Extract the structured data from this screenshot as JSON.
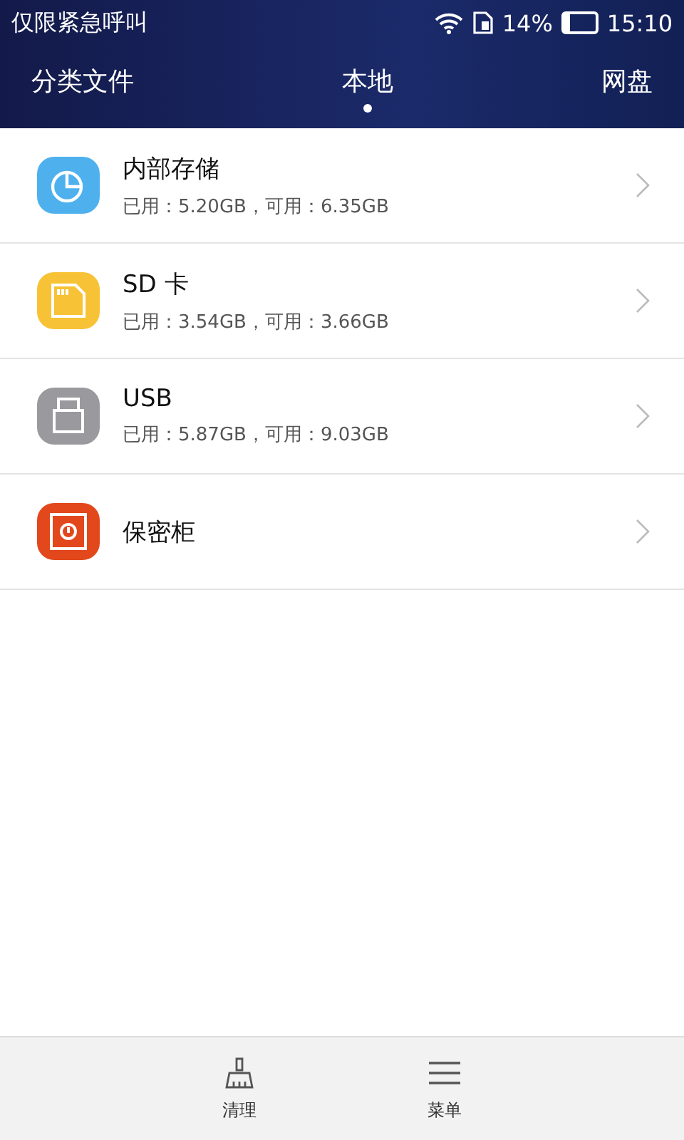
{
  "status_bar": {
    "carrier": "仅限紧急呼叫",
    "battery_text": "14%",
    "time": "15:10"
  },
  "tabs": [
    {
      "label": "分类文件",
      "selected": false
    },
    {
      "label": "本地",
      "selected": true
    },
    {
      "label": "网盘",
      "selected": false
    }
  ],
  "storage_list": [
    {
      "kind": "pie",
      "color": "#4eb1ee",
      "title": "内部存储",
      "detail": "已用：5.20GB，可用：6.35GB"
    },
    {
      "kind": "sd",
      "color": "#f8c236",
      "title": "SD 卡",
      "detail": "已用：3.54GB，可用：3.66GB"
    },
    {
      "kind": "usb",
      "color": "#9a9a9e",
      "title": "USB",
      "detail": "已用：5.87GB，可用：9.03GB"
    },
    {
      "kind": "safe",
      "color": "#e2481c",
      "title": "保密柜"
    }
  ],
  "bottom_bar": [
    {
      "kind": "broom",
      "label": "清理"
    },
    {
      "kind": "menu",
      "label": "菜单"
    }
  ]
}
